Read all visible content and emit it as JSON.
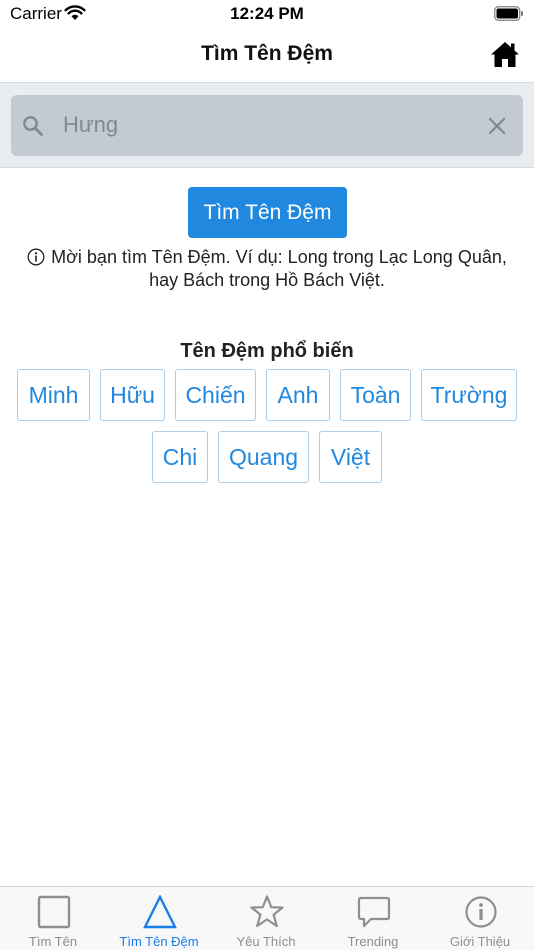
{
  "status_bar": {
    "carrier": "Carrier",
    "time": "12:24 PM"
  },
  "nav": {
    "title": "Tìm Tên Đệm",
    "home_icon": "home-icon"
  },
  "search": {
    "value": "",
    "placeholder": "Hưng"
  },
  "search_button": {
    "label": "Tìm Tên Đệm"
  },
  "hint": {
    "text": "Mời bạn tìm Tên Đệm. Ví dụ: Long trong Lạc Long Quân, hay Bách trong Hồ Bách Việt.",
    "icon": "info-circle-icon"
  },
  "popular": {
    "title": "Tên Đệm phổ biến",
    "items": [
      "Minh",
      "Hữu",
      "Chiến",
      "Anh",
      "Toàn",
      "Trường",
      "Chi",
      "Quang",
      "Việt"
    ]
  },
  "tabs": [
    {
      "label": "Tìm Tên",
      "icon": "square-icon",
      "active": false
    },
    {
      "label": "Tìm Tên Đệm",
      "icon": "triangle-icon",
      "active": true
    },
    {
      "label": "Yêu Thích",
      "icon": "star-icon",
      "active": false
    },
    {
      "label": "Trending",
      "icon": "chat-bubble-icon",
      "active": false
    },
    {
      "label": "Giới Thiệu",
      "icon": "info-icon",
      "active": false
    }
  ],
  "colors": {
    "accent": "#2188e0",
    "tab_active": "#1a7de8",
    "tab_inactive": "#8e8e93"
  }
}
